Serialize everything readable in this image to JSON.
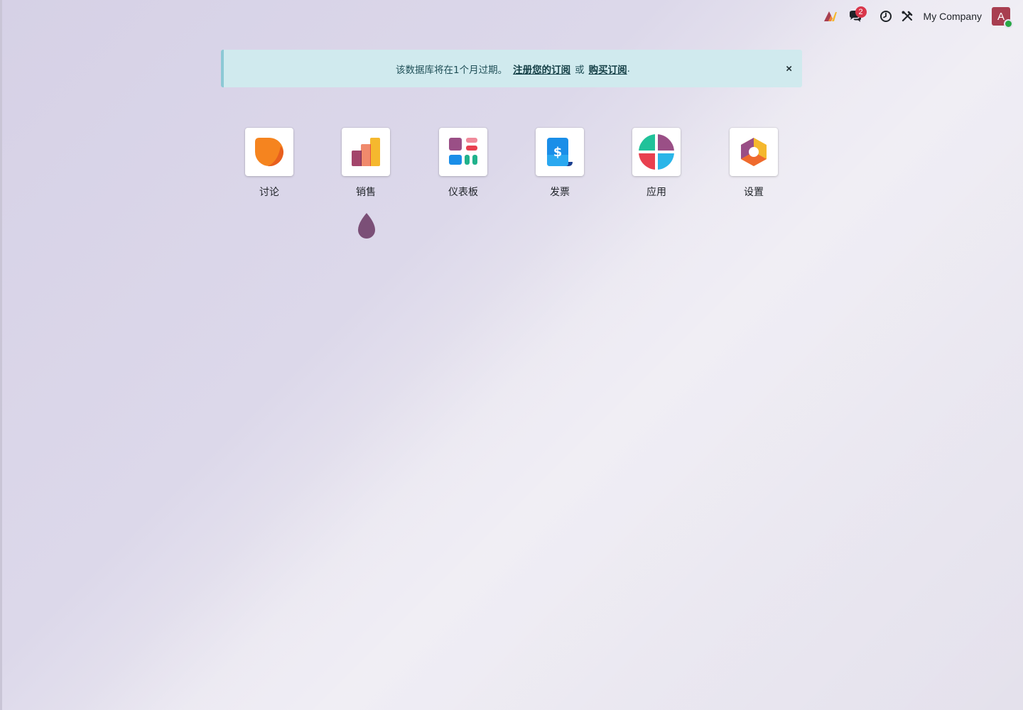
{
  "systray": {
    "chat_badge": "2",
    "company": "My Company",
    "avatar_letter": "A"
  },
  "alert": {
    "message": "该数据库将在1个月过期。",
    "register_link": "注册您的订阅",
    "or": "或",
    "buy_link": "购买订阅",
    "period": ".",
    "close": "×"
  },
  "apps": [
    {
      "label": "讨论",
      "icon": "discuss-icon"
    },
    {
      "label": "销售",
      "icon": "sales-icon"
    },
    {
      "label": "仪表板",
      "icon": "dashboard-icon"
    },
    {
      "label": "发票",
      "icon": "invoice-icon"
    },
    {
      "label": "应用",
      "icon": "apps-icon"
    },
    {
      "label": "设置",
      "icon": "settings-icon"
    }
  ],
  "colors": {
    "alert_bg": "#d0eaee",
    "badge": "#d9364a",
    "avatar": "#a83e50",
    "drop": "#7b4f77"
  }
}
